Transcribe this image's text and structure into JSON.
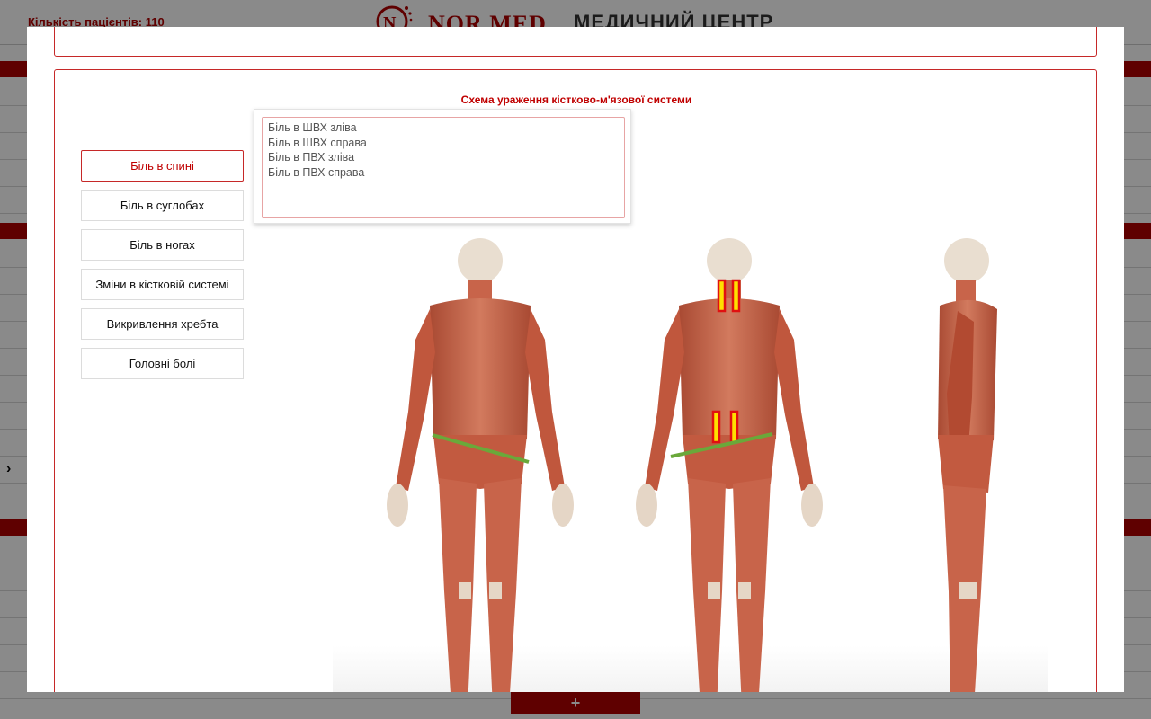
{
  "page": {
    "patients_count": "Кількість пацієнтів: 110",
    "brand": "NOR MED",
    "center": "МЕДИЧНИЙ ЦЕНТР",
    "add_button": "+",
    "chevron": "›"
  },
  "modal": {
    "scheme_title": "Схема ураження кістково-м'язової системи",
    "categories": [
      {
        "label": "Біль в спині",
        "active": true
      },
      {
        "label": "Біль в суглобах"
      },
      {
        "label": "Біль в ногах"
      },
      {
        "label": "Зміни в кістковій системі"
      },
      {
        "label": "Викривлення хребта"
      },
      {
        "label": "Головні болі"
      }
    ],
    "symptoms": [
      "Біль в ШВХ зліва",
      "Біль в ШВХ справа",
      "Біль в ПВХ зліва",
      "Біль в ПВХ справа"
    ],
    "views": [
      "front-view",
      "back-view",
      "side-view"
    ],
    "colors": {
      "accent": "#c00000",
      "marker_yellow": "#ffe000",
      "marker_red": "#e01010",
      "line_green": "#6aa83a",
      "muscle": "#c8644a"
    }
  }
}
